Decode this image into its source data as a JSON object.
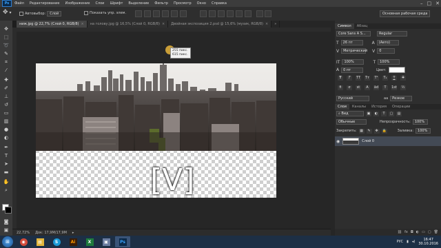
{
  "app": {
    "logo": "Ps"
  },
  "menu": [
    "Файл",
    "Редактирование",
    "Изображение",
    "Слои",
    "Шрифт",
    "Выделение",
    "Фильтр",
    "Просмотр",
    "Окно",
    "Справка"
  ],
  "options": {
    "autoselect_label": "Автовыбор:",
    "autoselect_value": "Слой",
    "show_controls_label": "Показать упр. элем.",
    "workspace": "Основная рабочая среда"
  },
  "tabs": [
    {
      "label": "ниж.jpg @ 22,7% (Слой 0, RGB/8)",
      "active": true
    },
    {
      "label": "на голову.jpg @ 16,5% (Слой 0, RGB/8)",
      "active": false
    },
    {
      "label": "Двойная экспозиция 2.psd @ 15,6% (музик, RGB/8)",
      "active": false
    }
  ],
  "canvas": {
    "tooltip_line1": "255 пикс.",
    "tooltip_line2": "615 пикс.",
    "watermark": "[V]"
  },
  "status": {
    "zoom": "22,72%",
    "doc": "Док: 17,9M/17,9M"
  },
  "character_panel": {
    "tabs": [
      "Символ",
      "Абзац"
    ],
    "font_family": "Core Sans A S...",
    "font_style": "Regular",
    "size": "26 пт",
    "leading": "(Авто)",
    "kerning": "Метрический",
    "tracking": "0",
    "vscale": "100%",
    "hscale": "100%",
    "baseline": "0 пт",
    "color_label": "Цвет:",
    "language": "Русский",
    "aa_label": "aа",
    "aa_value": "Резкое",
    "style_buttons": [
      "T",
      "T",
      "TT",
      "Tт",
      "T¹",
      "T₁",
      "T",
      "T"
    ],
    "ot_buttons": [
      "fi",
      "σ",
      "st",
      "A",
      "ād",
      "T",
      "1st",
      "½"
    ]
  },
  "layers_panel": {
    "tabs": [
      "Слои",
      "Каналы",
      "История",
      "Операции"
    ],
    "kind": "Вид",
    "blend_mode": "Обычные",
    "opacity_label": "Непрозрачность:",
    "opacity_value": "100%",
    "lock_label": "Закрепить:",
    "fill_label": "Заливка:",
    "fill_value": "100%",
    "layers": [
      {
        "name": "Слой 0"
      }
    ]
  },
  "taskbar": {
    "apps": [
      {
        "name": "chrome",
        "glyph": "◉",
        "color": "#d24a3a"
      },
      {
        "name": "explorer",
        "glyph": "▤",
        "color": "#e2b53c"
      },
      {
        "name": "skype",
        "glyph": "S",
        "color": "#1a9ad6"
      },
      {
        "name": "illustrator",
        "glyph": "Ai",
        "color": "#3b1d08"
      },
      {
        "name": "excel",
        "glyph": "X",
        "color": "#1e7a3c"
      },
      {
        "name": "files",
        "glyph": "▣",
        "color": "#6a7ca0"
      },
      {
        "name": "photoshop",
        "glyph": "Ps",
        "color": "#0b2a4a"
      }
    ],
    "lang": "РУС",
    "time": "16:47",
    "date": "30.10.2016"
  }
}
